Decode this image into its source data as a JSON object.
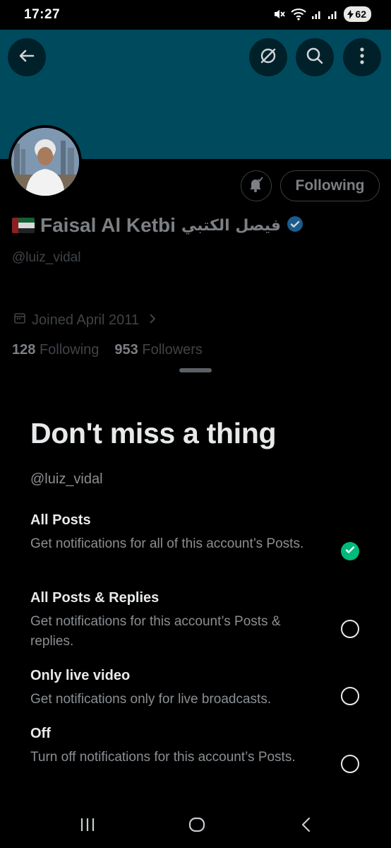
{
  "status_bar": {
    "time": "17:27",
    "battery": "62",
    "icons": [
      "mute-icon",
      "wifi-icon",
      "signal-icon",
      "signal-icon",
      "battery-charging-icon"
    ]
  },
  "header": {
    "buttons": [
      "back-arrow-icon",
      "translate-icon",
      "search-icon",
      "more-vertical-icon"
    ]
  },
  "profile": {
    "display_name": "Faisal Al Ketbi",
    "arabic_name": "فيصل الكتبي",
    "handle": "@luiz_vidal",
    "verified": true,
    "joined": "Joined April 2011",
    "following_count": "128",
    "following_label": "Following",
    "followers_count": "953",
    "followers_label": "Followers",
    "follow_button_label": "Following"
  },
  "sheet": {
    "title": "Don't miss a thing",
    "handle": "@luiz_vidal",
    "options": [
      {
        "title": "All Posts",
        "description": "Get notifications for all of this account’s Posts.",
        "selected": true
      },
      {
        "title": "All Posts & Replies",
        "description": "Get notifications for this account’s Posts & replies.",
        "selected": false
      },
      {
        "title": "Only live video",
        "description": "Get notifications only for live broadcasts.",
        "selected": false
      },
      {
        "title": "Off",
        "description": "Turn off notifications for this account’s Posts.",
        "selected": false
      }
    ]
  },
  "nav_bar": {
    "buttons": [
      "recent-apps-icon",
      "home-icon",
      "back-icon"
    ]
  },
  "colors": {
    "banner": "#004a5e",
    "verified": "#1d9bf0",
    "selected": "#00ba7c",
    "background": "#000000",
    "primary_text": "#e7e9ea",
    "secondary_text": "#8b8f93"
  }
}
